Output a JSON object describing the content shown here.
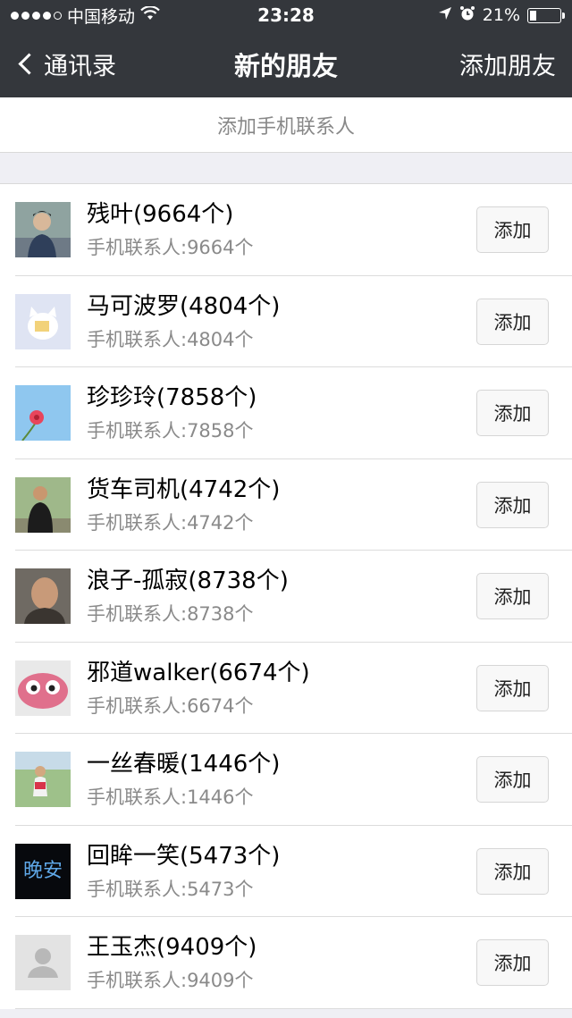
{
  "status_bar": {
    "carrier": "中国移动",
    "time": "23:28",
    "battery": "21%",
    "battery_level": 0.21
  },
  "nav": {
    "back_label": "通讯录",
    "title": "新的朋友",
    "right_label": "添加朋友"
  },
  "add_phone_label": "添加手机联系人",
  "contacts": [
    {
      "name": "残叶(9664个)",
      "sub": "手机联系人:9664个",
      "button": "添加",
      "avatar": "photo-young-man-icon"
    },
    {
      "name": "马可波罗(4804个)",
      "sub": "手机联系人:4804个",
      "button": "添加",
      "avatar": "cartoon-cat-icon"
    },
    {
      "name": "珍珍玲(7858个)",
      "sub": "手机联系人:7858个",
      "button": "添加",
      "avatar": "pink-flower-icon"
    },
    {
      "name": "货车司机(4742个)",
      "sub": "手机联系人:4742个",
      "button": "添加",
      "avatar": "photo-man-outdoor-icon"
    },
    {
      "name": "浪子-孤寂(8738个)",
      "sub": "手机联系人:8738个",
      "button": "添加",
      "avatar": "photo-older-man-icon"
    },
    {
      "name": "邪道walker(6674个)",
      "sub": "手机联系人:6674个",
      "button": "添加",
      "avatar": "pink-creature-icon"
    },
    {
      "name": "一丝春暖(1446个)",
      "sub": "手机联系人:1446个",
      "button": "添加",
      "avatar": "photo-person-outdoor-icon"
    },
    {
      "name": "回眸一笑(5473个)",
      "sub": "手机联系人:5473个",
      "button": "添加",
      "avatar": "night-text-icon",
      "avatar_text": "晚安"
    },
    {
      "name": "王玉杰(9409个)",
      "sub": "手机联系人:9409个",
      "button": "添加",
      "avatar": "default-person-icon"
    }
  ]
}
